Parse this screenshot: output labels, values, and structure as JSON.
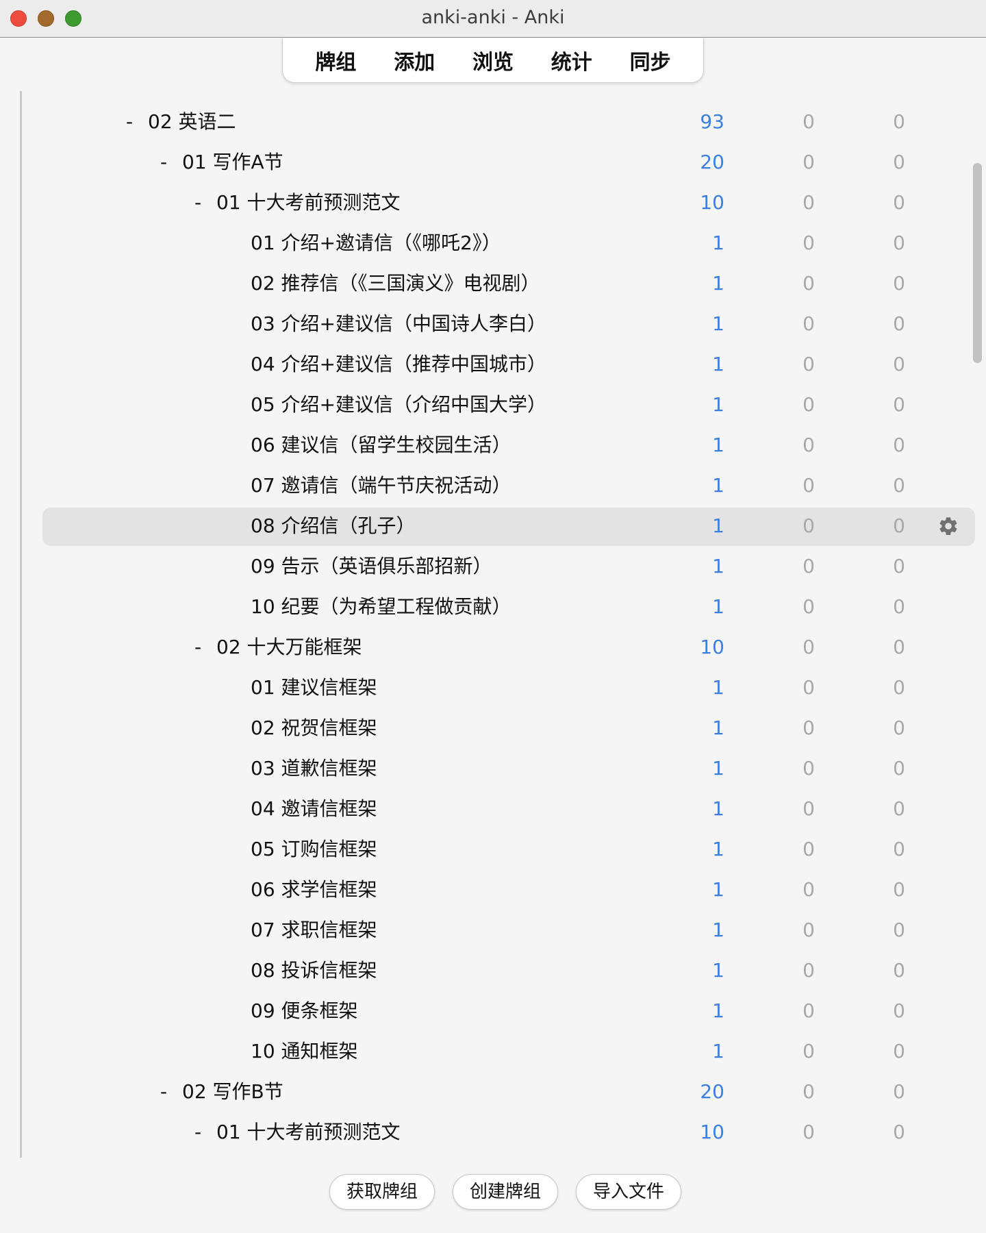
{
  "window": {
    "title": "anki-anki - Anki"
  },
  "toolbar": {
    "decks": "牌组",
    "add": "添加",
    "browse": "浏览",
    "stats": "统计",
    "sync": "同步"
  },
  "deck_rows": [
    {
      "toggle": "-",
      "name": "02 英语二",
      "level": 0,
      "new": "93",
      "learn": "0",
      "review": "0"
    },
    {
      "toggle": "-",
      "name": "01 写作A节",
      "level": 1,
      "new": "20",
      "learn": "0",
      "review": "0"
    },
    {
      "toggle": "-",
      "name": "01 十大考前预测范文",
      "level": 2,
      "new": "10",
      "learn": "0",
      "review": "0"
    },
    {
      "toggle": "",
      "name": "01 介绍+邀请信（《哪吒2》）",
      "level": 3,
      "new": "1",
      "learn": "0",
      "review": "0"
    },
    {
      "toggle": "",
      "name": "02 推荐信（《三国演义》电视剧）",
      "level": 3,
      "new": "1",
      "learn": "0",
      "review": "0"
    },
    {
      "toggle": "",
      "name": "03 介绍+建议信（中国诗人李白）",
      "level": 3,
      "new": "1",
      "learn": "0",
      "review": "0"
    },
    {
      "toggle": "",
      "name": "04 介绍+建议信（推荐中国城市）",
      "level": 3,
      "new": "1",
      "learn": "0",
      "review": "0"
    },
    {
      "toggle": "",
      "name": "05 介绍+建议信（介绍中国大学）",
      "level": 3,
      "new": "1",
      "learn": "0",
      "review": "0"
    },
    {
      "toggle": "",
      "name": "06 建议信（留学生校园生活）",
      "level": 3,
      "new": "1",
      "learn": "0",
      "review": "0"
    },
    {
      "toggle": "",
      "name": "07 邀请信（端午节庆祝活动）",
      "level": 3,
      "new": "1",
      "learn": "0",
      "review": "0"
    },
    {
      "toggle": "",
      "name": "08 介绍信（孔子）",
      "level": 3,
      "new": "1",
      "learn": "0",
      "review": "0",
      "selected": true
    },
    {
      "toggle": "",
      "name": "09 告示（英语俱乐部招新）",
      "level": 3,
      "new": "1",
      "learn": "0",
      "review": "0"
    },
    {
      "toggle": "",
      "name": "10 纪要（为希望工程做贡献）",
      "level": 3,
      "new": "1",
      "learn": "0",
      "review": "0"
    },
    {
      "toggle": "-",
      "name": "02 十大万能框架",
      "level": 2,
      "new": "10",
      "learn": "0",
      "review": "0"
    },
    {
      "toggle": "",
      "name": "01 建议信框架",
      "level": 3,
      "new": "1",
      "learn": "0",
      "review": "0"
    },
    {
      "toggle": "",
      "name": "02 祝贺信框架",
      "level": 3,
      "new": "1",
      "learn": "0",
      "review": "0"
    },
    {
      "toggle": "",
      "name": "03 道歉信框架",
      "level": 3,
      "new": "1",
      "learn": "0",
      "review": "0"
    },
    {
      "toggle": "",
      "name": "04 邀请信框架",
      "level": 3,
      "new": "1",
      "learn": "0",
      "review": "0"
    },
    {
      "toggle": "",
      "name": "05 订购信框架",
      "level": 3,
      "new": "1",
      "learn": "0",
      "review": "0"
    },
    {
      "toggle": "",
      "name": "06 求学信框架",
      "level": 3,
      "new": "1",
      "learn": "0",
      "review": "0"
    },
    {
      "toggle": "",
      "name": "07 求职信框架",
      "level": 3,
      "new": "1",
      "learn": "0",
      "review": "0"
    },
    {
      "toggle": "",
      "name": "08 投诉信框架",
      "level": 3,
      "new": "1",
      "learn": "0",
      "review": "0"
    },
    {
      "toggle": "",
      "name": "09 便条框架",
      "level": 3,
      "new": "1",
      "learn": "0",
      "review": "0"
    },
    {
      "toggle": "",
      "name": "10 通知框架",
      "level": 3,
      "new": "1",
      "learn": "0",
      "review": "0"
    },
    {
      "toggle": "-",
      "name": "02 写作B节",
      "level": 1,
      "new": "20",
      "learn": "0",
      "review": "0"
    },
    {
      "toggle": "-",
      "name": "01 十大考前预测范文",
      "level": 2,
      "new": "10",
      "learn": "0",
      "review": "0"
    }
  ],
  "footer": {
    "get_shared": "获取牌组",
    "create_deck": "创建牌组",
    "import_file": "导入文件"
  },
  "icons": {
    "row_options": "gear-icon"
  },
  "colors": {
    "new_count": "#3b7fe0",
    "zero_count": "#a8a8a8",
    "selected_row": "#e3e3e3"
  }
}
